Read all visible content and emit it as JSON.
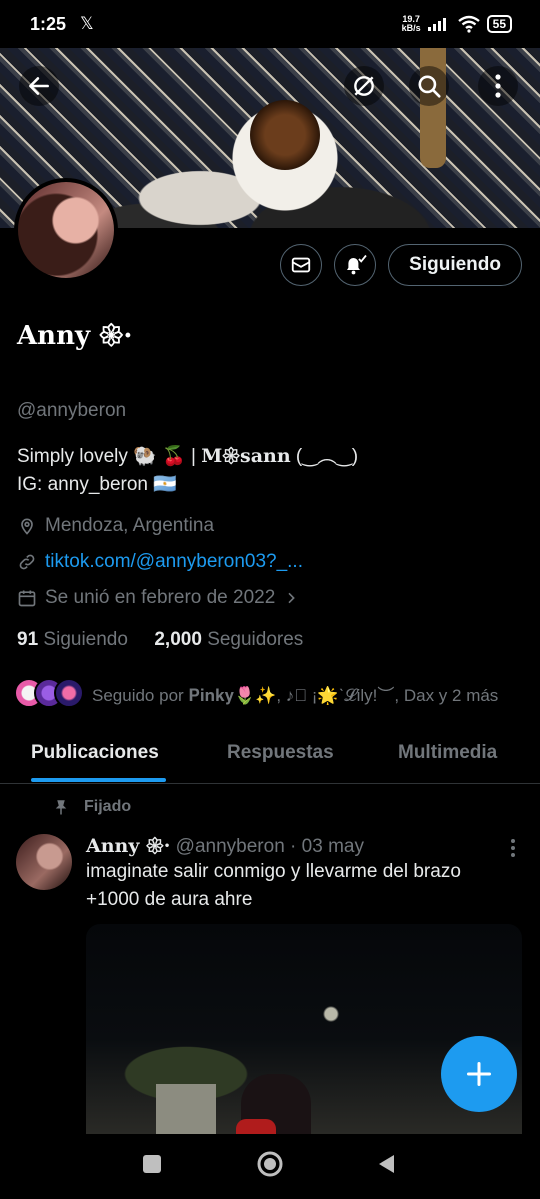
{
  "status_bar": {
    "time": "1:25",
    "notification": "𝕏",
    "speed_top": "19.7",
    "speed_bottom": "kB/s",
    "battery": "55"
  },
  "header_icons": [
    "back-arrow-icon",
    "exclude-icon",
    "search-icon",
    "more-vertical-icon"
  ],
  "profile": {
    "follow_label": "Siguiendo",
    "name": "Anny 𑁍·",
    "handle": "@annyberon",
    "bio_line1_pre": "Simply lovely 🐏 🍒 | ",
    "bio_line1_name": "M𑁍sann",
    "bio_line1_post": " (‿︵‿)",
    "bio_line2": "IG: anny_beron  🇦🇷",
    "location": "Mendoza, Argentina",
    "website": "tiktok.com/@annyberon03?_...",
    "joined": "Se unió en febrero de 2022",
    "following_count": "91",
    "following_label": "Siguiendo",
    "followers_count": "2,000",
    "followers_label": "Seguidores",
    "followed_by": "Seguido por 𝐏𝐢𝐧𝐤𝐲🌷✨, ♪⃝ ¡🌟ˋ𝓛ily!︶, Dax y 2 más"
  },
  "tabs": [
    {
      "label": "Publicaciones",
      "active": true
    },
    {
      "label": "Respuestas",
      "active": false
    },
    {
      "label": "Multimedia",
      "active": false
    }
  ],
  "pinned_post": {
    "pinned_label": "Fijado",
    "author_name": "Anny 𑁍·",
    "author_handle": "@annyberon",
    "date": "· 03 may",
    "text": "imaginate salir conmigo y llevarme del brazo +1000 de aura ahre"
  },
  "colors": {
    "accent": "#1d9bf0",
    "secondary_text": "#71767b",
    "primary_text": "#e7e9ea",
    "background": "#000000"
  }
}
